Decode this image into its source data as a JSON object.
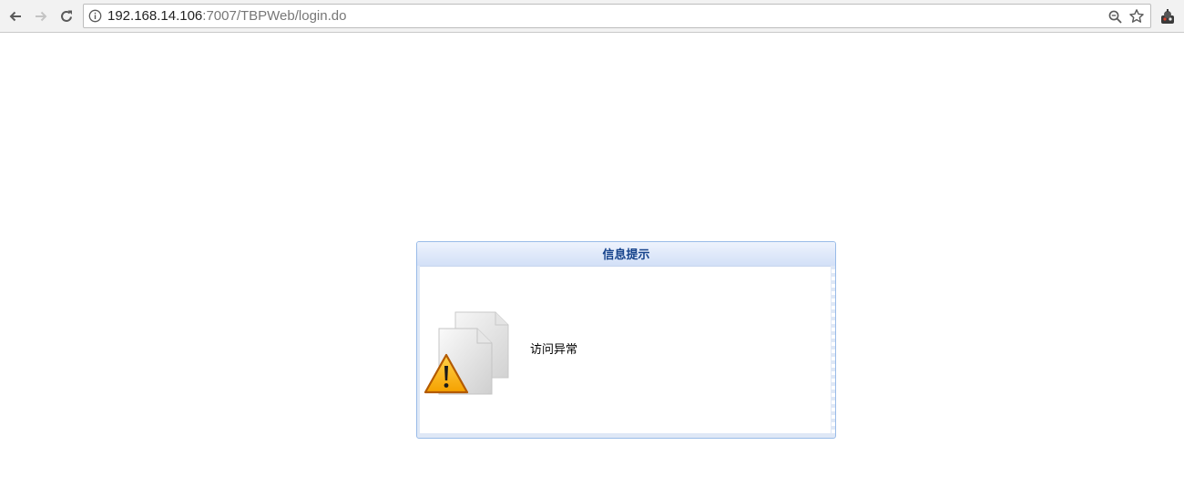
{
  "browser": {
    "address_host": "192.168.14.106",
    "address_rest": ":7007/TBPWeb/login.do",
    "icons": {
      "back": "back-arrow-icon",
      "forward": "forward-arrow-icon",
      "reload": "reload-icon",
      "site_info": "info-icon",
      "zoom": "zoom-icon",
      "bookmark": "star-icon",
      "extension": "extension-icon"
    }
  },
  "dialog": {
    "title": "信息提示",
    "message": "访问异常",
    "icon": "warning-document-icon",
    "colors": {
      "border": "#99bbe8",
      "title_text": "#15428b",
      "header_bg": "#dde7f9"
    }
  }
}
